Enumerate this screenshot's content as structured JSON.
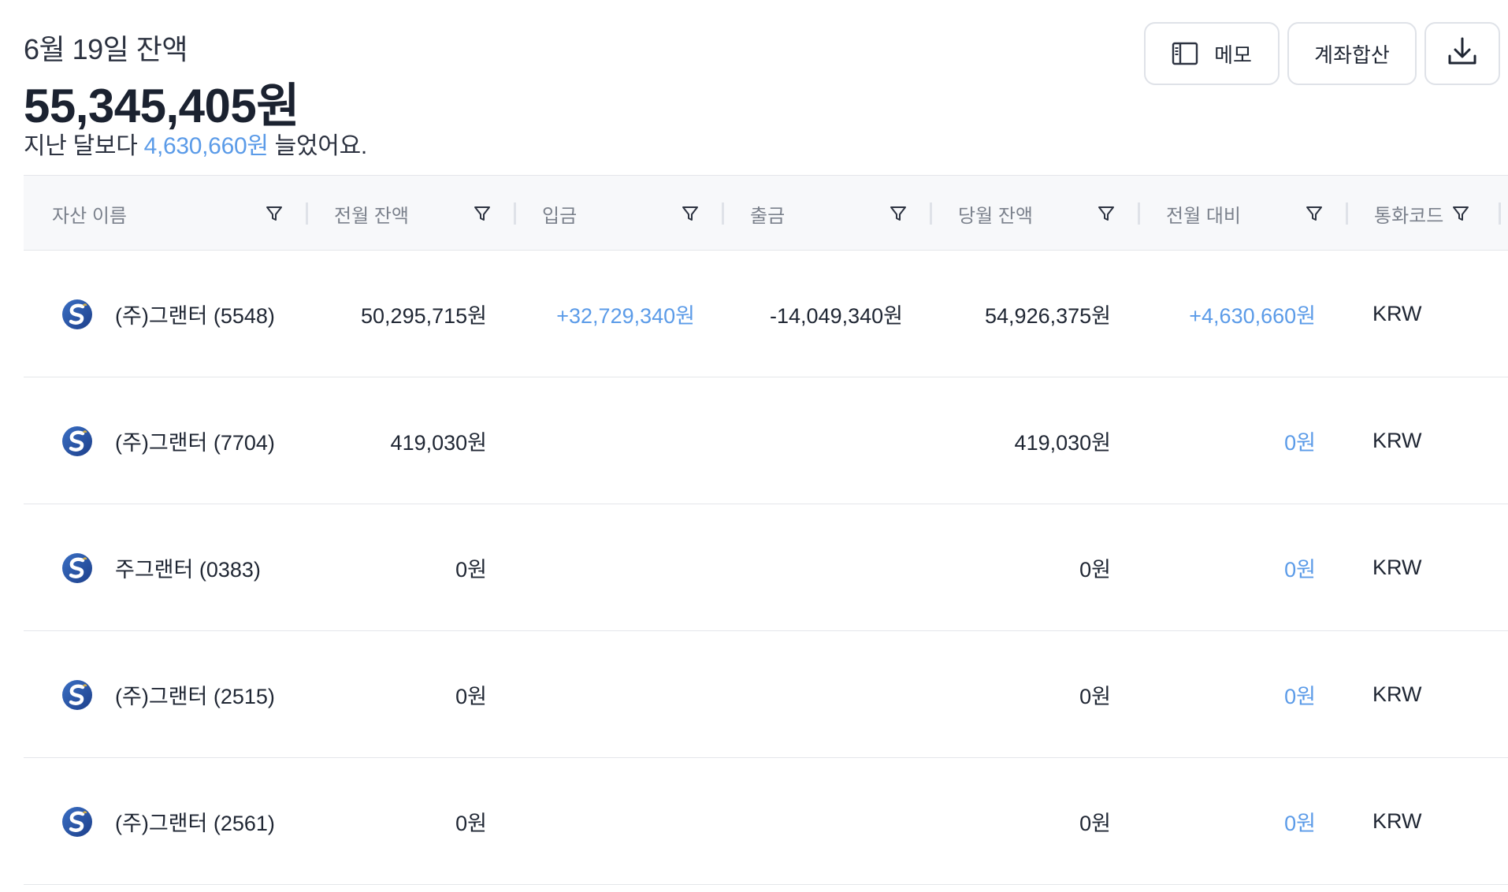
{
  "header": {
    "date_label": "6월 19일 잔액",
    "total_balance": "55,345,405원",
    "change_prefix": "지난 달보다 ",
    "change_amount": "4,630,660원",
    "change_suffix": " 늘었어요."
  },
  "toolbar": {
    "memo_label": "메모",
    "sum_label": "계좌합산",
    "download_icon": "download-icon",
    "memo_icon": "sidebar-panel-icon"
  },
  "colors": {
    "accent_blue": "#5b9be8",
    "text_primary": "#1f2633",
    "header_bg": "#f7f8fa",
    "border": "#e4e6ea"
  },
  "table": {
    "columns": [
      {
        "label": "자산 이름",
        "key": "name"
      },
      {
        "label": "전월 잔액",
        "key": "prev_balance"
      },
      {
        "label": "입금",
        "key": "deposit"
      },
      {
        "label": "출금",
        "key": "withdrawal"
      },
      {
        "label": "당월 잔액",
        "key": "curr_balance"
      },
      {
        "label": "전월 대비",
        "key": "vs_prev"
      },
      {
        "label": "통화코드",
        "key": "currency"
      }
    ],
    "rows": [
      {
        "name": "(주)그랜터 (5548)",
        "prev_balance": "50,295,715원",
        "deposit": "+32,729,340원",
        "withdrawal": "-14,049,340원",
        "curr_balance": "54,926,375원",
        "vs_prev": "+4,630,660원",
        "currency": "KRW",
        "logo": "bank-logo-icon"
      },
      {
        "name": "(주)그랜터 (7704)",
        "prev_balance": "419,030원",
        "deposit": "",
        "withdrawal": "",
        "curr_balance": "419,030원",
        "vs_prev": "0원",
        "currency": "KRW",
        "logo": "bank-logo-icon"
      },
      {
        "name": "주그랜터 (0383)",
        "prev_balance": "0원",
        "deposit": "",
        "withdrawal": "",
        "curr_balance": "0원",
        "vs_prev": "0원",
        "currency": "KRW",
        "logo": "bank-logo-icon"
      },
      {
        "name": "(주)그랜터 (2515)",
        "prev_balance": "0원",
        "deposit": "",
        "withdrawal": "",
        "curr_balance": "0원",
        "vs_prev": "0원",
        "currency": "KRW",
        "logo": "bank-logo-icon"
      },
      {
        "name": "(주)그랜터 (2561)",
        "prev_balance": "0원",
        "deposit": "",
        "withdrawal": "",
        "curr_balance": "0원",
        "vs_prev": "0원",
        "currency": "KRW",
        "logo": "bank-logo-icon"
      }
    ]
  }
}
